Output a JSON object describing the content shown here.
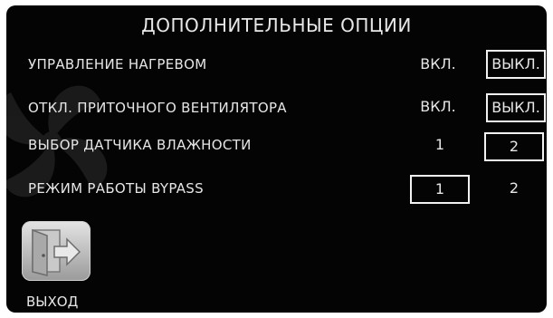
{
  "title": "ДОПОЛНИТЕЛЬНЫЕ ОПЦИИ",
  "rows": [
    {
      "label": "УПРАВЛЕНИЕ НАГРЕВОМ",
      "option_a": "ВКЛ.",
      "option_b": "ВЫКЛ.",
      "selected": "b"
    },
    {
      "label": "ОТКЛ. ПРИТОЧНОГО ВЕНТИЛЯТОРА",
      "option_a": "ВКЛ.",
      "option_b": "ВЫКЛ.",
      "selected": "b"
    },
    {
      "label": "ВЫБОР ДАТЧИКА ВЛАЖНОСТИ",
      "option_a": "1",
      "option_b": "2",
      "selected": "b"
    },
    {
      "label": "РЕЖИМ РАБОТЫ BYPASS",
      "option_a": "1",
      "option_b": "2",
      "selected": "a"
    }
  ],
  "exit": {
    "label": "ВЫХОД",
    "icon": "exit-door-icon"
  },
  "colors": {
    "background": "#040404",
    "text": "#e6e6e6",
    "selection_border": "#f2f2f2"
  }
}
